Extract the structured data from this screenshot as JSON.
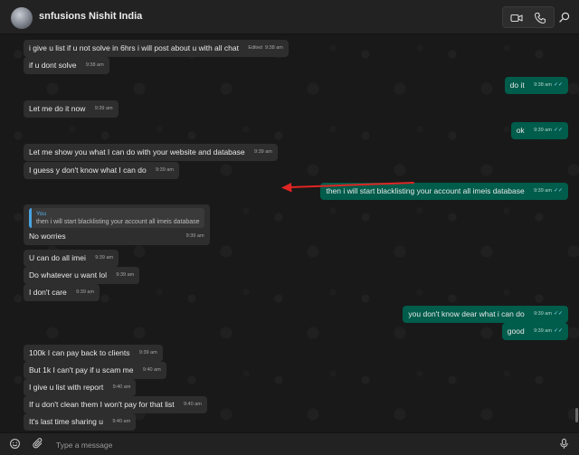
{
  "header": {
    "contact_name": "snfusions Nishit India"
  },
  "icons": {
    "video": "video-camera-icon",
    "call": "phone-icon",
    "search": "search-icon",
    "emoji": "emoji-icon",
    "attach": "paperclip-icon",
    "mic": "microphone-icon",
    "scroll_down": "arrow-down-icon"
  },
  "colors": {
    "incoming_bubble": "#2e2e2e",
    "outgoing_bubble": "#005c4b",
    "annotation_arrow": "#e02424",
    "read_tick": "#8fd0f5"
  },
  "messages": [
    {
      "dir": "in",
      "text": "i give u list if u not solve in 6hrs i will post about u with all chat",
      "edited": "Edited",
      "time": "9:38 am"
    },
    {
      "dir": "in",
      "text": "if u dont solve",
      "time": "9:38 am"
    },
    {
      "dir": "out",
      "text": "do it",
      "time": "9:38 am"
    },
    {
      "dir": "in",
      "text": "Let me do it now",
      "time": "9:39 am"
    },
    {
      "dir": "out",
      "text": "ok",
      "time": "9:39 am"
    },
    {
      "dir": "in",
      "text": "Let me show you what I can do with your website and database",
      "time": "9:39 am"
    },
    {
      "dir": "in",
      "text": "I guess y don't know what I can do",
      "time": "9:39 am"
    },
    {
      "dir": "out",
      "text": "then i will start blacklisting your account all imeis database",
      "time": "9:39 am"
    },
    {
      "dir": "in",
      "quote_author": "You",
      "quote_text": "then i will start blacklisting your account all imeis database",
      "text": "No worries",
      "time": "9:39 am"
    },
    {
      "dir": "in",
      "text": "U can do all imei",
      "time": "9:39 am"
    },
    {
      "dir": "in",
      "text": "Do whatever u want lol",
      "time": "9:39 am"
    },
    {
      "dir": "in",
      "text": "I don't care",
      "time": "9:39 am"
    },
    {
      "dir": "out",
      "text": "you don't know dear what i can do",
      "time": "9:39 am"
    },
    {
      "dir": "out",
      "text": "good",
      "time": "9:39 am"
    },
    {
      "dir": "in",
      "text": "100k I can pay back to clients",
      "time": "9:39 am"
    },
    {
      "dir": "in",
      "text": "But 1k I can't pay if u scam me",
      "time": "9:40 am"
    },
    {
      "dir": "in",
      "text": "I give u list with report",
      "time": "9:40 am"
    },
    {
      "dir": "in",
      "text": "If u don't clean them I won't pay for that list",
      "time": "9:40 am"
    },
    {
      "dir": "in",
      "text": "It's last time sharing u",
      "time": "9:40 am"
    }
  ],
  "composer": {
    "placeholder": "Type a message"
  }
}
